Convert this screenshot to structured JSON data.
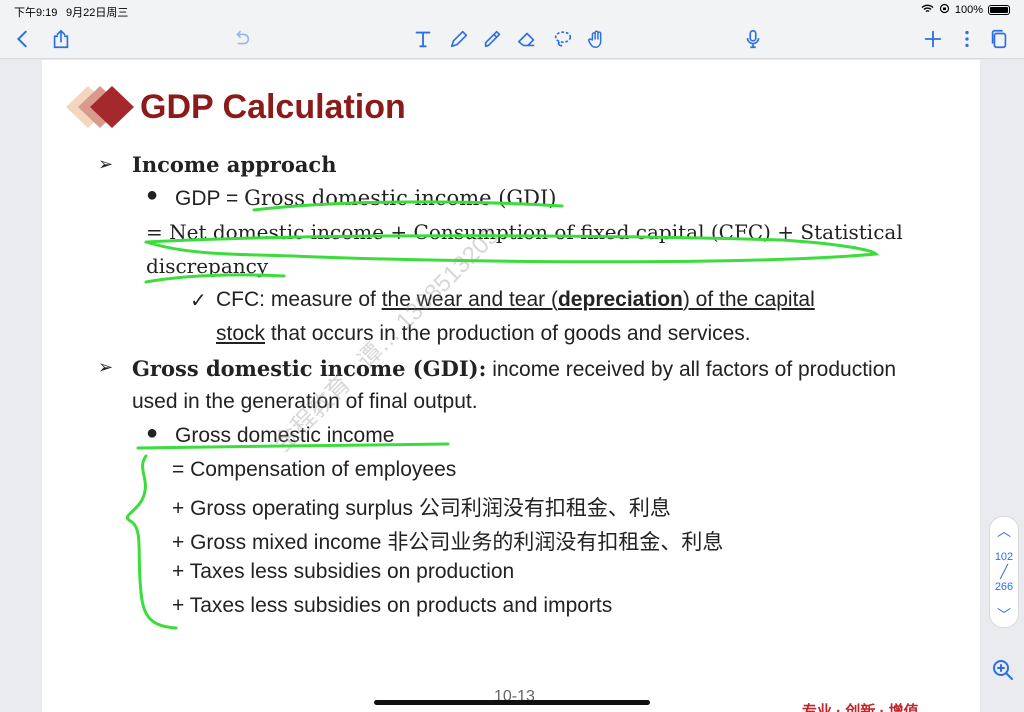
{
  "status_bar": {
    "time": "下午9:19",
    "date": "9月22日周三",
    "battery": "100%"
  },
  "toolbar": {
    "icons": [
      "back-icon",
      "share-icon",
      "undo-icon",
      "text-tool-icon",
      "pen-icon",
      "highlighter-icon",
      "eraser-icon",
      "lasso-icon",
      "hand-icon",
      "microphone-icon",
      "add-icon",
      "more-icon",
      "pages-icon"
    ]
  },
  "slide": {
    "title": "GDP Calculation",
    "income_approach": "Income approach",
    "gdp_line_prefix": "GDP = ",
    "gdp_line_gdi": "Gross domestic income (GDI)",
    "net_line_1": "= Net domestic income + Consumption of fixed capital (CFC) + Statistical",
    "net_line_2": "discrepancy",
    "cfc_prefix": "CFC: measure of ",
    "cfc_wear": "the wear and tear (",
    "cfc_depreciation": "depreciation",
    "cfc_of": ") of the capital",
    "cfc_stock": "stock",
    "cfc_rest": " that occurs in the production of goods and services.",
    "gdi_bold": "Gross domestic income (GDI):",
    "gdi_def_1": " income received by all factors of production",
    "gdi_def_2": "used in the generation of final output.",
    "gdi_bullet": "Gross domestic income",
    "components": [
      "=  Compensation of employees",
      "+ Gross operating surplus 公司利润没有扣租金、利息",
      "+ Gross mixed income  非公司业务的利润没有扣租金、利息",
      "+ Taxes less subsidies on production",
      "+ Taxes less subsidies on products and imports"
    ],
    "watermark": "金程教育 · 谭… 1368513203",
    "page_footer": "10-13",
    "slogan": "专业 · 创新 · 增值"
  },
  "pager": {
    "current": "102",
    "total": "266"
  },
  "colors": {
    "title": "#8b1a1a",
    "annotation": "#3ddc3d",
    "accent": "#2c6fe0"
  }
}
